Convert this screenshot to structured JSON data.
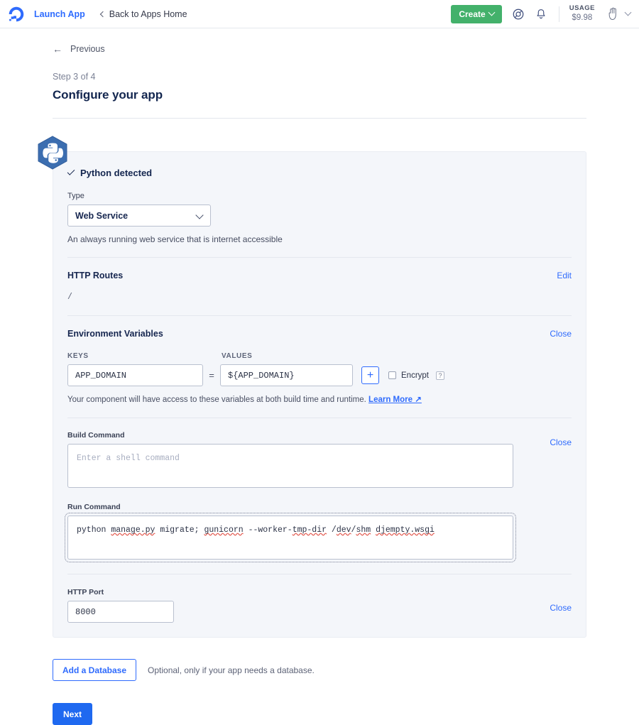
{
  "topnav": {
    "logo_icon": "digitalocean-droplet-logo",
    "launch_app": "Launch App",
    "back_link": "Back to Apps Home",
    "create_label": "Create",
    "help_icon": "lifebuoy-help-icon",
    "bell_icon": "notification-bell-icon",
    "usage_label": "USAGE",
    "usage_amount": "$9.98",
    "avatar_icon": "user-avatar"
  },
  "page": {
    "previous": "Previous",
    "step": "Step 3 of 4",
    "title": "Configure your app"
  },
  "card": {
    "badge_icon": "python-logo-hexagon",
    "detected": "Python detected",
    "type_label": "Type",
    "type_value": "Web Service",
    "type_description": "An always running web service that is internet accessible",
    "routes": {
      "title": "HTTP Routes",
      "action": "Edit",
      "value": "/"
    },
    "env": {
      "title": "Environment Variables",
      "action": "Close",
      "keys_header": "KEYS",
      "values_header": "VALUES",
      "equals": "=",
      "key_value": "APP_DOMAIN",
      "value_value": "${APP_DOMAIN}",
      "add_label": "+",
      "encrypt_label": "Encrypt",
      "help_icon_label": "?",
      "note_text": "Your component will have access to these variables at both build time and runtime. ",
      "note_link": "Learn More ↗"
    },
    "build": {
      "label": "Build Command",
      "placeholder": "Enter a shell command",
      "value": "",
      "action": "Close"
    },
    "run": {
      "label": "Run Command",
      "action": "",
      "value": "python manage.py migrate; gunicorn --worker-tmp-dir /dev/shm djempty.wsgi",
      "tokens": [
        {
          "t": "python ",
          "spell": false
        },
        {
          "t": "manage.py",
          "spell": true
        },
        {
          "t": " migrate; ",
          "spell": false
        },
        {
          "t": "gunicorn",
          "spell": true
        },
        {
          "t": " --worker-",
          "spell": false
        },
        {
          "t": "tmp-dir",
          "spell": true
        },
        {
          "t": " /",
          "spell": false
        },
        {
          "t": "dev",
          "spell": true
        },
        {
          "t": "/",
          "spell": false
        },
        {
          "t": "shm",
          "spell": true
        },
        {
          "t": " ",
          "spell": false
        },
        {
          "t": "djempty.wsgi",
          "spell": true
        }
      ]
    },
    "port": {
      "label": "HTTP Port",
      "value": "8000",
      "action": "Close"
    }
  },
  "footer": {
    "add_database": "Add a Database",
    "database_note": "Optional, only if your app needs a database.",
    "next": "Next"
  },
  "colors": {
    "brand_blue": "#2f6bfd",
    "create_green": "#43b16b",
    "next_blue": "#1f69f0",
    "card_bg": "#f4f6fa",
    "python_badge": "#3c6eb0"
  }
}
